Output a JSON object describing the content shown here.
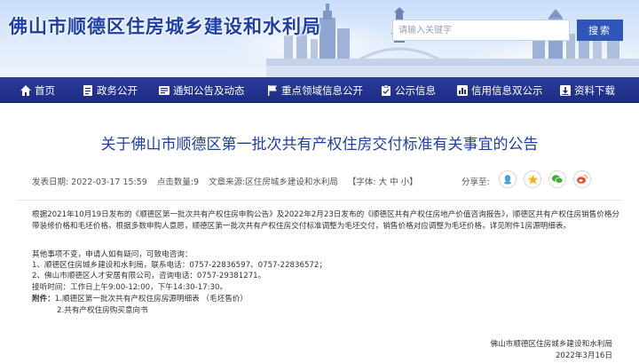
{
  "header": {
    "site_title": "佛山市顺德区住房城乡建设和水利局",
    "search_placeholder": "请输入关键字",
    "search_button": "搜索"
  },
  "nav": {
    "items": [
      {
        "label": "首页",
        "icon": "home-icon"
      },
      {
        "label": "政务公开",
        "icon": "document-list-icon"
      },
      {
        "label": "通知公告及动态",
        "icon": "notice-icon"
      },
      {
        "label": "重点领域信息公开",
        "icon": "flag-icon"
      },
      {
        "label": "公示信息",
        "icon": "clipboard-icon"
      },
      {
        "label": "信用信息双公示",
        "icon": "bar-chart-icon"
      },
      {
        "label": "资料下载",
        "icon": "download-icon"
      }
    ],
    "active_index": 2
  },
  "article": {
    "title": "关于佛山市顺德区第一批次共有产权住房交付标准有关事宜的公告",
    "meta": {
      "publish_time": "发表日期: 2022-03-17 15:59",
      "clicks": "点击数量:9",
      "source": "文章来源:区住房城乡建设和水利局",
      "font_size": "【字体: 大 中 小】"
    },
    "share_label": "分享至:",
    "share_icons": [
      "qq-icon",
      "star-icon",
      "wechat-icon",
      "weibo-icon"
    ],
    "paragraph1": "根据2021年10月19日发布的《顺德区第一批次共有产权住房申购公告》及2022年2月23日发布的《顺德区共有产权住房地产价值咨询报告》，顺德区共有产权住房销售价格分带装修价格和毛坯价格。根据多数申购人意愿，顺德区第一批次共有产权住房交付标准调整为毛坯交付，销售价格对应调整为毛坯价格，详见附件1房源明细表。",
    "paragraph2": "其他事项不变，申请人如有疑问，可致电咨询：",
    "contact1": "1、顺德区住房城乡建设和水利局，联系电话：0757-22836597、0757-22836572；",
    "contact2": "2、佛山市顺德区人才安居有限公司，咨询电话：0757-29381271。",
    "hours": "接听时间：工作日上午9:00-12:00，下午14:30-17:30。",
    "attachments_label": "附件：",
    "attachment1": "1.顺德区第一批次共有产权住房房源明细表 （毛坯售价）",
    "attachment2": "2.共有产权住房购买意向书",
    "signature_org": "佛山市顺德区住房城乡建设和水利局",
    "signature_date": "2022年3月16日"
  },
  "colors": {
    "title_blue": "#1d3fa8",
    "nav_bg": "#1e2c84",
    "search_button": "#2f56b6"
  }
}
